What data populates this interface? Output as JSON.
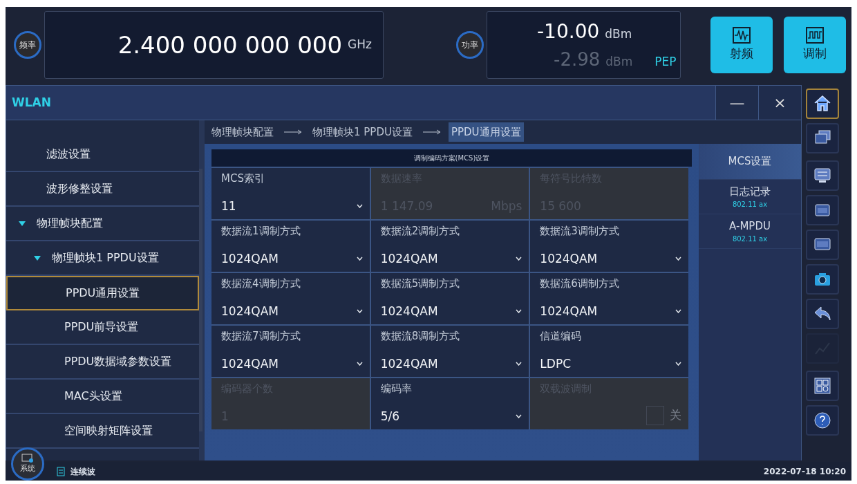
{
  "frequency": {
    "badge": "频率",
    "value": "2.400 000 000 000",
    "unit": "GHz"
  },
  "power": {
    "badge": "功率",
    "value": "-10.00",
    "unit": "dBm",
    "pep_value": "-2.98",
    "pep_unit": "dBm",
    "pep_label": "PEP"
  },
  "mode_buttons": [
    {
      "label": "射频",
      "kind": "rf"
    },
    {
      "label": "调制",
      "kind": "mod"
    }
  ],
  "window": {
    "title": "WLAN",
    "controls": [
      "—",
      "×"
    ]
  },
  "sidebar": {
    "items": [
      {
        "label": "滤波设置",
        "selected": false
      },
      {
        "label": "波形修整设置",
        "selected": false
      },
      {
        "label": "物理帧块配置",
        "selected": false,
        "expanded": true,
        "children": [
          {
            "label": "物理帧块1 PPDU设置",
            "selected": false,
            "expanded": true,
            "children": [
              {
                "label": "PPDU通用设置",
                "selected": true
              },
              {
                "label": "PPDU前导设置",
                "selected": false
              },
              {
                "label": "PPDU数据域参数设置",
                "selected": false
              },
              {
                "label": "MAC头设置",
                "selected": false
              },
              {
                "label": "空间映射矩阵设置",
                "selected": false
              }
            ]
          }
        ]
      }
    ]
  },
  "breadcrumb": [
    {
      "label": "物理帧块配置",
      "selected": false
    },
    {
      "label": "物理帧块1 PPDU设置",
      "selected": false
    },
    {
      "label": "PPDU通用设置",
      "selected": true
    }
  ],
  "panel": {
    "title": "调制编码方案(MCS)设置",
    "fields": [
      {
        "kind": "select",
        "label": "MCS索引",
        "value": "11",
        "disabled": false
      },
      {
        "kind": "readonly",
        "label": "数据速率",
        "value": "1 147.09",
        "unit": "Mbps",
        "disabled": true
      },
      {
        "kind": "readonly",
        "label": "每符号比特数",
        "value": "15 600",
        "disabled": true
      },
      {
        "kind": "select",
        "label": "数据流1调制方式",
        "value": "1024QAM",
        "disabled": false
      },
      {
        "kind": "select",
        "label": "数据流2调制方式",
        "value": "1024QAM",
        "disabled": false
      },
      {
        "kind": "select",
        "label": "数据流3调制方式",
        "value": "1024QAM",
        "disabled": false
      },
      {
        "kind": "select",
        "label": "数据流4调制方式",
        "value": "1024QAM",
        "disabled": false
      },
      {
        "kind": "select",
        "label": "数据流5调制方式",
        "value": "1024QAM",
        "disabled": false
      },
      {
        "kind": "select",
        "label": "数据流6调制方式",
        "value": "1024QAM",
        "disabled": false
      },
      {
        "kind": "select",
        "label": "数据流7调制方式",
        "value": "1024QAM",
        "disabled": false
      },
      {
        "kind": "select",
        "label": "数据流8调制方式",
        "value": "1024QAM",
        "disabled": false
      },
      {
        "kind": "select",
        "label": "信道编码",
        "value": "LDPC",
        "disabled": false
      },
      {
        "kind": "readonly",
        "label": "编码器个数",
        "value": "1",
        "disabled": true
      },
      {
        "kind": "select",
        "label": "编码率",
        "value": "5/6",
        "disabled": false
      },
      {
        "kind": "toggle",
        "label": "双载波调制",
        "state_label": "关",
        "checked": false,
        "disabled": true
      }
    ]
  },
  "side_tabs": [
    {
      "label": "MCS设置",
      "selected": true
    },
    {
      "label": "日志记录",
      "sub": "802.11 ax",
      "selected": false
    },
    {
      "label": "A-MPDU",
      "sub": "802.11 ax",
      "selected": false
    }
  ],
  "toolbar": [
    {
      "kind": "home",
      "selected": true,
      "disabled": false
    },
    {
      "kind": "windows",
      "selected": false,
      "disabled": false
    },
    {
      "kind": "display",
      "selected": false,
      "disabled": false
    },
    {
      "kind": "scpi-console",
      "selected": false,
      "disabled": false
    },
    {
      "kind": "scpi",
      "selected": false,
      "disabled": false
    },
    {
      "kind": "camera",
      "selected": false,
      "disabled": false
    },
    {
      "kind": "undo",
      "selected": false,
      "disabled": false
    },
    {
      "kind": "graph",
      "selected": false,
      "disabled": true
    },
    {
      "kind": "grid",
      "selected": false,
      "disabled": false
    },
    {
      "kind": "help",
      "selected": false,
      "disabled": false
    }
  ],
  "status_bar": {
    "system_label": "系统",
    "mode": "连续波",
    "datetime": "2022-07-18 10:20"
  }
}
